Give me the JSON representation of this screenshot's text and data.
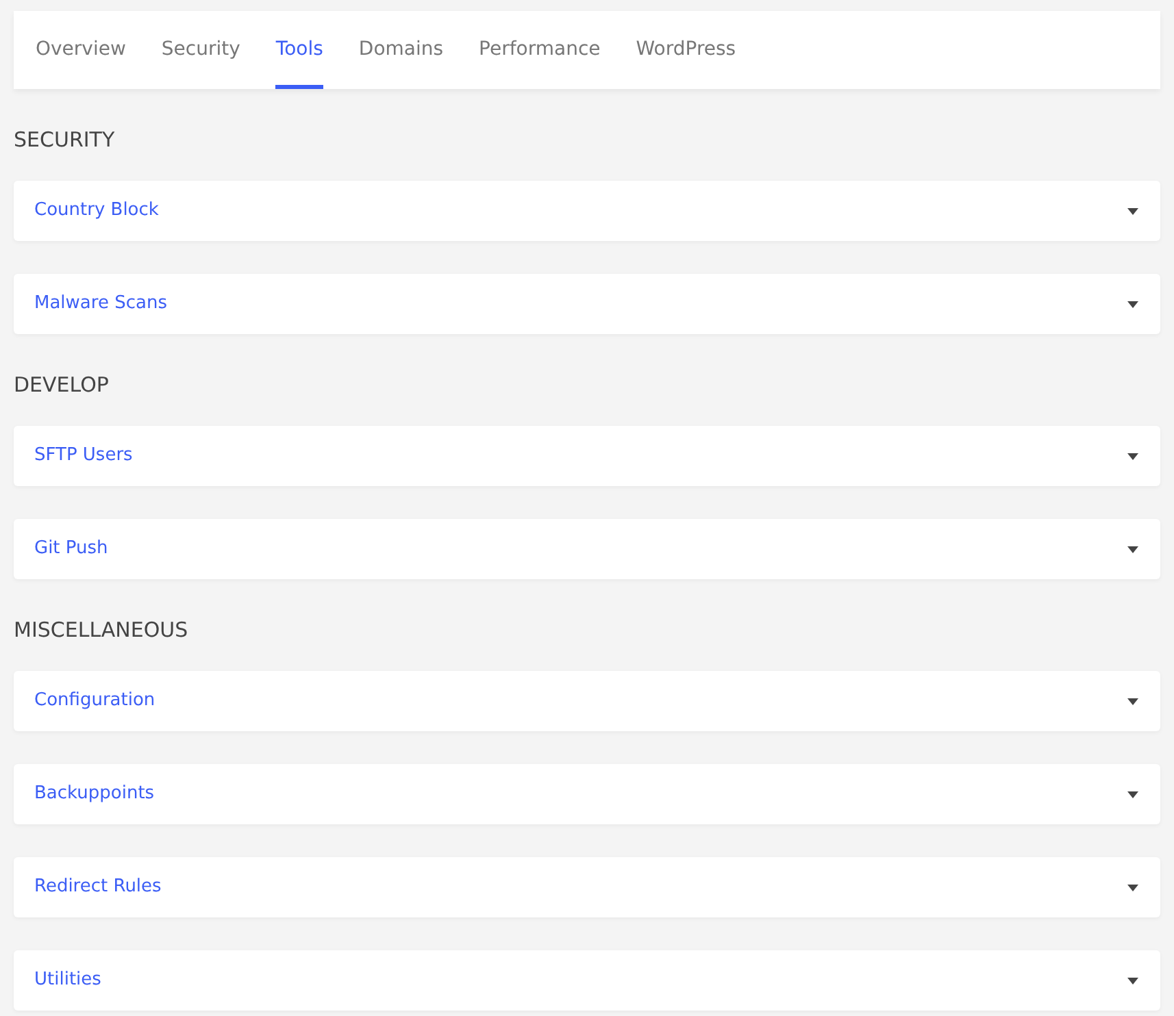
{
  "tabs": [
    {
      "label": "Overview",
      "selected": false
    },
    {
      "label": "Security",
      "selected": false
    },
    {
      "label": "Tools",
      "selected": true
    },
    {
      "label": "Domains",
      "selected": false
    },
    {
      "label": "Performance",
      "selected": false
    },
    {
      "label": "WordPress",
      "selected": false
    }
  ],
  "sections": [
    {
      "heading": "SECURITY",
      "items": [
        {
          "label": "Country Block",
          "expanded": false
        },
        {
          "label": "Malware Scans",
          "expanded": false
        }
      ]
    },
    {
      "heading": "DEVELOP",
      "items": [
        {
          "label": "SFTP Users",
          "expanded": false
        },
        {
          "label": "Git Push",
          "expanded": false
        }
      ]
    },
    {
      "heading": "MISCELLANEOUS",
      "items": [
        {
          "label": "Configuration",
          "expanded": false
        },
        {
          "label": "Backuppoints",
          "expanded": false
        },
        {
          "label": "Redirect Rules",
          "expanded": false
        },
        {
          "label": "Utilities",
          "expanded": false
        }
      ]
    }
  ]
}
